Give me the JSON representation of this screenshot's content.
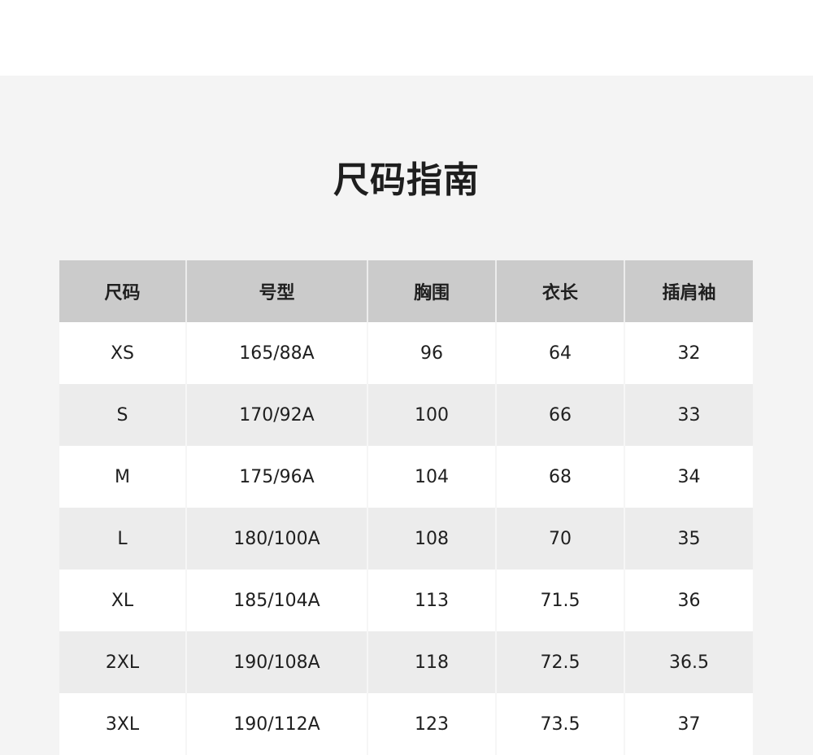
{
  "title": "尺码指南",
  "table": {
    "headers": [
      "尺码",
      "号型",
      "胸围",
      "衣长",
      "插肩袖"
    ],
    "rows": [
      [
        "XS",
        "165/88A",
        "96",
        "64",
        "32"
      ],
      [
        "S",
        "170/92A",
        "100",
        "66",
        "33"
      ],
      [
        "M",
        "175/96A",
        "104",
        "68",
        "34"
      ],
      [
        "L",
        "180/100A",
        "108",
        "70",
        "35"
      ],
      [
        "XL",
        "185/104A",
        "113",
        "71.5",
        "36"
      ],
      [
        "2XL",
        "190/108A",
        "118",
        "72.5",
        "36.5"
      ],
      [
        "3XL",
        "190/112A",
        "123",
        "73.5",
        "37"
      ]
    ]
  }
}
